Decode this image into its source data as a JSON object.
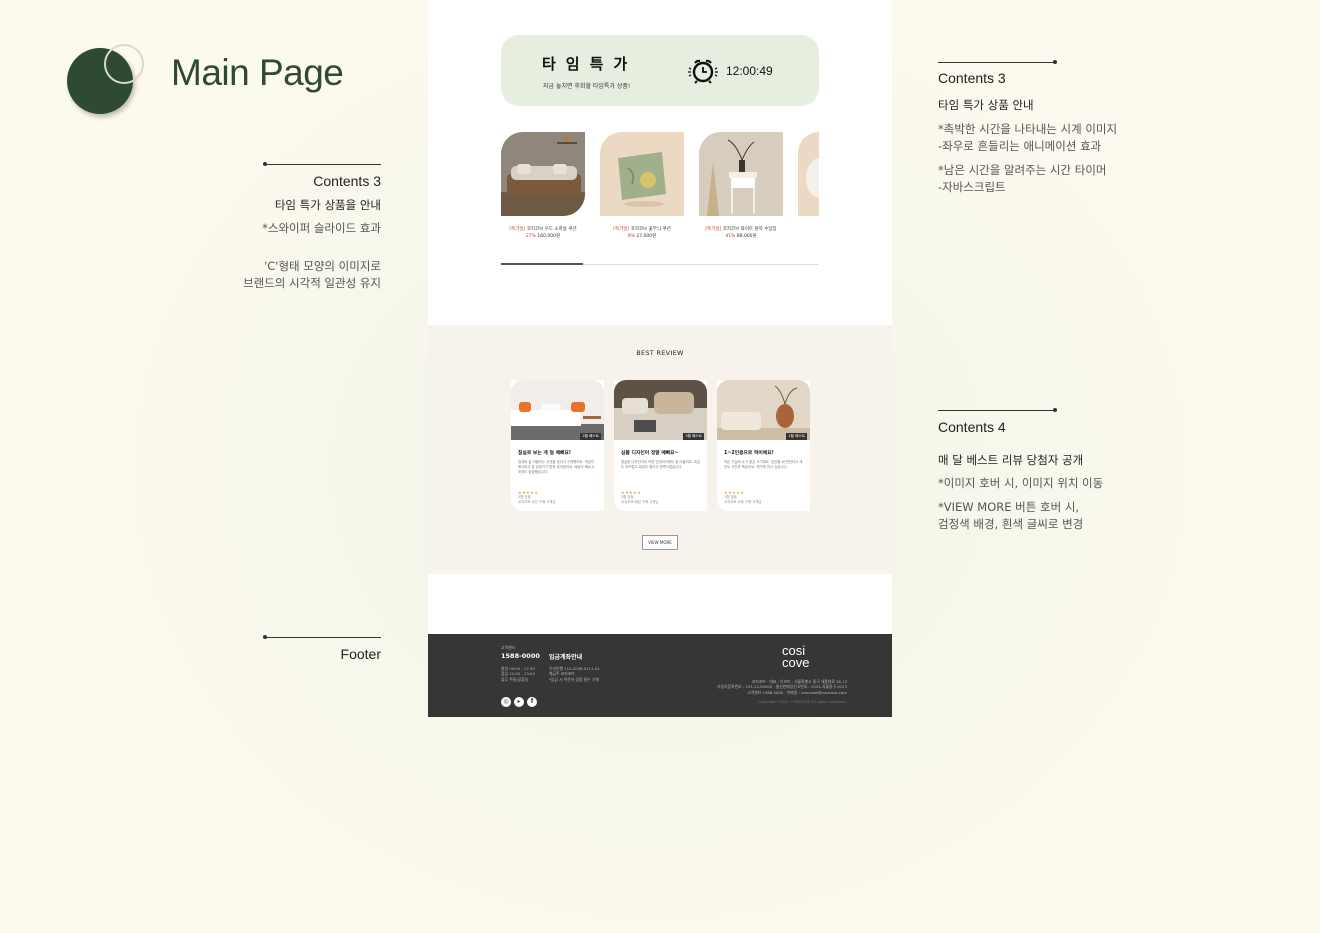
{
  "header": {
    "title": "Main Page"
  },
  "left_notes": [
    {
      "title": "Contents 3",
      "subtitle": "타임 특가 상품을 안내",
      "lines": [
        "*스와이퍼 슬라이드 효과",
        "",
        "'C'형태 모양의 이미지로",
        "브랜드의 시각적 일관성 유지"
      ]
    },
    {
      "title": "Footer"
    }
  ],
  "right_notes": [
    {
      "title": "Contents 3",
      "subtitle": "타임 특가 상품 안내",
      "lines": [
        "*촉박한 시간을 나타내는 시계 이미지",
        "-좌우로 흔들리는 애니메이션 효과",
        "*남은 시간을 알려주는 시간 타이머",
        "-자바스크립트"
      ]
    },
    {
      "title": "Contents 4",
      "subtitle": "매 달 베스트 리뷰 당첨자 공개",
      "lines": [
        "*이미지 호버 시, 이미지 위치 이동",
        "*VIEW MORE 버튼 호버 시,",
        "검정색 배경, 흰색 글씨로 변경"
      ]
    }
  ],
  "timesale": {
    "title": "타임특가",
    "subtitle": "지금 놓치면 후회할 타임특가 상품!",
    "time": "12:00:49",
    "products": [
      {
        "tag": "[특가딜]",
        "name": "코지코브 우드 소파용 쿠션",
        "discount": "27%",
        "price": "160,000원"
      },
      {
        "tag": "[특가딜]",
        "name": "코지코브 꽃무늬 쿠션",
        "discount": "9%",
        "price": "27,000원"
      },
      {
        "tag": "[특가딜]",
        "name": "코지코브 화이트 원목 수납장",
        "discount": "41%",
        "price": "88,000원"
      }
    ]
  },
  "review": {
    "heading": "BEST REVIEW",
    "cards": [
      {
        "badge": "2월 베스트",
        "title": "침실로 보는 게 딜 예뻐요!",
        "text": "침대와 잘 어울리는 쿠션을 찾다가 구매했어요. 색감이 화사하고 방 분위기가 한층 밝아졌어요. 배송도 빠르고 포장도 꼼꼼했습니다.",
        "stars": "★★★★★",
        "meta": [
          "2월 당첨",
          "코지코브 쿠션 구매 고객님"
        ]
      },
      {
        "badge": "3월 베스트",
        "title": "심플 디자인이 정말 예뻐요~",
        "text": "깔끔한 디자인이라 어떤 인테리어에도 잘 어울려요. 촉감도 부드럽고 마감도 좋아서 만족스럽습니다.",
        "stars": "★★★★★",
        "meta": [
          "3월 당첨",
          "코지코브 베딩 구매 고객님"
        ]
      },
      {
        "badge": "1월 베스트",
        "title": "1~2인용으로 딱이에요!",
        "text": "작은 거실에 두기 좋은 크기예요. 앉았을 때 편안하고 색감도 사진과 똑같아요. 재구매 의사 있습니다.",
        "stars": "★★★★★",
        "meta": [
          "1월 당첨",
          "코지코브 소파 구매 고객님"
        ]
      }
    ],
    "button": "VIEW MORE"
  },
  "footer": {
    "cs_label": "고객센터",
    "phone": "1588-0000",
    "hours": [
      "평일 09:00 - 17:30",
      "점심 12:00 - 13:00",
      "휴무 주말/공휴일"
    ],
    "bank_title": "입금계좌안내",
    "bank": [
      "우리은행 112-2036-5111-01",
      "예금주 코지코브",
      "*입금 시 주문자 성함 필수 기재"
    ],
    "logo": [
      "cosi",
      "cove"
    ],
    "company": [
      "코지코브 · 대표 : 이코브 · 서울특별시 중구 세종대로 26 13",
      "사업자등록번호 : 123-12-00000 · 통신판매업신고번호 : 2024-서울중구-0123",
      "고객센터 1588-0000 · 이메일 : cosicove@cosicove.com"
    ],
    "copyright": "Copyright 2024. COSICOVE All rights reserved."
  },
  "colors": {
    "brand": "#2f4a32",
    "timebox": "#e6eee0",
    "review_bg": "#f7f3ec",
    "footer_bg": "#363636",
    "sale_red": "#c0392b"
  }
}
